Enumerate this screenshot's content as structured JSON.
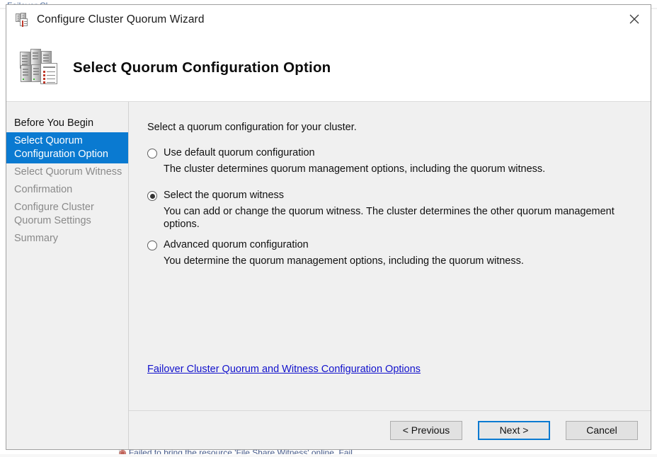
{
  "background": {
    "top_text": "Failover Cl...",
    "bottom_text": "Failed to bring the resource 'File Share Witness' online. Fail"
  },
  "window": {
    "title": "Configure Cluster Quorum Wizard",
    "title_icon": "cluster-icon",
    "close_icon": "close-icon"
  },
  "header": {
    "title": "Select Quorum Configuration Option",
    "icon": "cluster-servers-icon"
  },
  "sidebar": {
    "items": [
      {
        "label": "Before You Begin",
        "state": "done"
      },
      {
        "label": "Select Quorum Configuration Option",
        "state": "active"
      },
      {
        "label": "Select Quorum Witness",
        "state": "pending"
      },
      {
        "label": "Confirmation",
        "state": "pending"
      },
      {
        "label": "Configure Cluster Quorum Settings",
        "state": "pending"
      },
      {
        "label": "Summary",
        "state": "pending"
      }
    ]
  },
  "main": {
    "intro": "Select a quorum configuration for your cluster.",
    "options": [
      {
        "label": "Use default quorum configuration",
        "description": "The cluster determines quorum management options, including the quorum witness.",
        "selected": false
      },
      {
        "label": "Select the quorum witness",
        "description": "You can add or change the quorum witness. The cluster determines the other quorum management options.",
        "selected": true
      },
      {
        "label": "Advanced quorum configuration",
        "description": "You determine the quorum management options, including the quorum witness.",
        "selected": false
      }
    ],
    "link": "Failover Cluster Quorum and Witness Configuration Options"
  },
  "footer": {
    "previous": "< Previous",
    "next": "Next >",
    "cancel": "Cancel"
  },
  "colors": {
    "accent": "#0a7ad1",
    "link": "#1111cc",
    "window_bg": "#f0f0f0",
    "header_bg": "#ffffff"
  }
}
